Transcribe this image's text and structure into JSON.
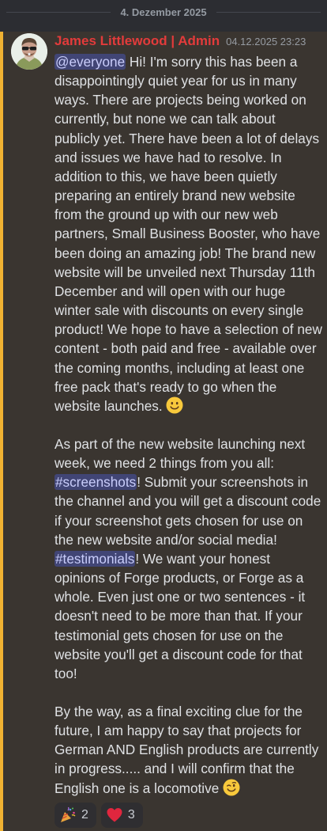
{
  "date_divider": "4. Dezember 2025",
  "message": {
    "author": "James Littlewood | Admin",
    "author_color": "#e33b3b",
    "timestamp": "04.12.2025 23:23",
    "accent_color": "#f0b232",
    "p1": {
      "mention": "@everyone",
      "text": " Hi! I'm sorry this has been a disappointingly quiet year for us in many ways. There are projects being worked on currently, but none we can talk about publicly yet. There have been a lot of delays and issues we have had to resolve. In addition to this, we have been quietly preparing an entirely brand new website from the ground up with our new web partners, Small Business Booster, who have been doing an amazing job! The brand new website will be unveiled next Thursday 11th December and will open with our huge winter sale with discounts on every single product! We hope to have a selection of new content - both paid and free - available over the coming months, including at least one free pack that's ready to go when the website launches. ",
      "emoji": "slightly-smiling-face"
    },
    "p2": {
      "intro": "As part of the new website launching next week, we need 2 things from you all: ",
      "channel1": "#screenshots",
      "text1": "! Submit your screenshots in the channel and you will get a discount code if your screenshot gets chosen for use on the new website and/or social media! ",
      "channel2": "#testimonials",
      "text2": "! We want your honest opinions of Forge products, or Forge as a whole. Even just one or two sentences - it doesn't need to be more than that. If your testimonial gets chosen for use on the website you'll get a discount code for that too!"
    },
    "p3": {
      "text": "By the way, as a final exciting clue for the future, I am happy to say that projects for German AND English products are currently in progress..... and I will confirm that the English one is a locomotive ",
      "emoji": "winking-face"
    },
    "reactions": [
      {
        "emoji": "party-popper",
        "count": "2"
      },
      {
        "emoji": "red-heart",
        "count": "3"
      }
    ]
  }
}
